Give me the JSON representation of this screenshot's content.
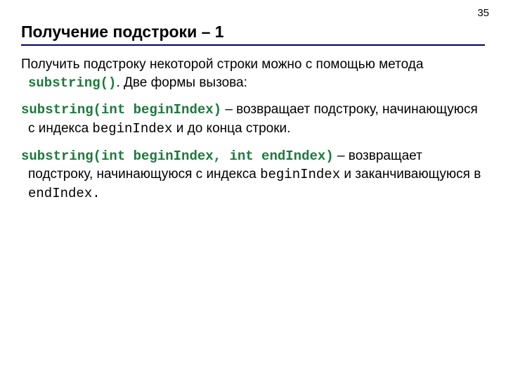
{
  "page_number": "35",
  "title": "Получение подстроки – 1",
  "p1": {
    "t1": "Получить подстроку некоторой строки можно с помощью метода ",
    "code1": "substring()",
    "t2": ". Две формы вызова:"
  },
  "p2": {
    "sig": "substring(int beginIndex)",
    "t1": " – возвращает подстроку, начинающуюся с индекса ",
    "code1": "beginIndex",
    "t2": " и до конца строки."
  },
  "p3": {
    "sig": "substring(int beginIndex, int endIndex)",
    "t1": " – возвращает подстроку, начинающуюся с индекса ",
    "code1": "beginIndex",
    "t2": " и заканчивающуюся в ",
    "code2": "endIndex.",
    "t3": ""
  }
}
